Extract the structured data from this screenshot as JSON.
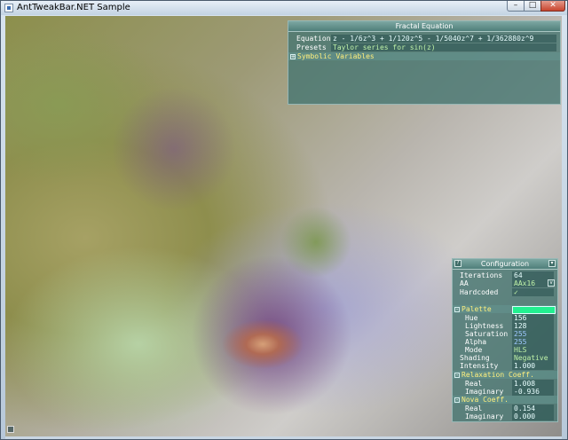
{
  "window": {
    "title": "AntTweakBar.NET Sample",
    "buttons": {
      "minimize": "–",
      "maximize": "□",
      "close": "✕"
    }
  },
  "fractal_bar": {
    "title": "Fractal Equation",
    "equation": {
      "label": "Equation",
      "value": "z - 1/6z^3 + 1/120z^5 - 1/5040z^7 + 1/362880z^9"
    },
    "presets": {
      "label": "Presets",
      "value": "Taylor series for sin(z)"
    },
    "symbolic": {
      "label": "Symbolic Variables",
      "toggle": "+"
    }
  },
  "config_bar": {
    "title": "Configuration",
    "iterations": {
      "label": "Iterations",
      "value": "64"
    },
    "aa": {
      "label": "AA",
      "value": "AAx16",
      "arrow": "v"
    },
    "hardcoded": {
      "label": "Hardcoded",
      "value": "✓"
    },
    "palette": {
      "label": "Palette",
      "toggle": "-",
      "color": "#22f090",
      "hue": {
        "label": "Hue",
        "value": "156"
      },
      "lightness": {
        "label": "Lightness",
        "value": "128"
      },
      "saturation": {
        "label": "Saturation",
        "value": "255"
      },
      "alpha": {
        "label": "Alpha",
        "value": "255"
      },
      "mode": {
        "label": "Mode",
        "value": "HLS"
      }
    },
    "shading": {
      "label": "Shading",
      "value": "Negative"
    },
    "intensity": {
      "label": "Intensity",
      "value": "1.000"
    },
    "relaxation": {
      "label": "Relaxation Coeff.",
      "toggle": "-",
      "real": {
        "label": "Real",
        "value": "1.008"
      },
      "imaginary": {
        "label": "Imaginary",
        "value": "-0.936"
      }
    },
    "nova": {
      "label": "Nova Coeff.",
      "toggle": "-",
      "real": {
        "label": "Real",
        "value": "0.154"
      },
      "imaginary": {
        "label": "Imaginary",
        "value": "0.000"
      }
    }
  }
}
